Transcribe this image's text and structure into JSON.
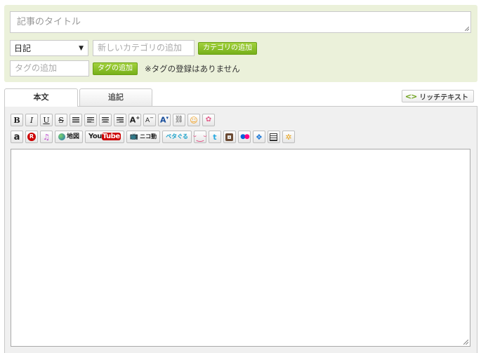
{
  "entry": {
    "title_placeholder": "記事のタイトル"
  },
  "category": {
    "selected": "日記",
    "new_placeholder": "新しいカテゴリの追加",
    "add_label": "カテゴリの追加"
  },
  "tags": {
    "input_placeholder": "タグの追加",
    "add_label": "タグの追加",
    "empty_message": "※タグの登録はありません"
  },
  "tabs": [
    {
      "label": "本文",
      "active": true
    },
    {
      "label": "追記",
      "active": false
    }
  ],
  "rich_text_label": "リッチテキスト",
  "toolbar": {
    "row1": [
      "bold-icon",
      "italic-icon",
      "underline-icon",
      "strikethrough-icon",
      "align-left-icon",
      "align-center-icon",
      "align-right-icon",
      "font-larger-icon",
      "font-smaller-icon",
      "font-color-icon",
      "link-icon",
      "emoji-icon",
      "picture-emoji-icon"
    ],
    "row2": [
      "amazon-icon",
      "rakuten-icon",
      "music-icon",
      "map-icon",
      "youtube-icon",
      "niconico-icon",
      "petacoru-icon",
      "emoticon-icon",
      "twitter-icon",
      "instagram-icon",
      "flickr-icon",
      "dropbox-icon",
      "list-icon",
      "photo-app-icon"
    ],
    "map_label": "地図",
    "youtube_you": "You",
    "youtube_tube": "Tube",
    "nico_label": "ニコ動",
    "peta_label": "ペタぐる",
    "amazon_glyph": "a",
    "rakuten_glyph": "R",
    "twitter_glyph": "t",
    "music_glyph": "♫"
  },
  "colors": {
    "panel_bg": "#ebf1da",
    "accent_green": "#76b01a",
    "editor_bg": "#f0f0f0"
  }
}
